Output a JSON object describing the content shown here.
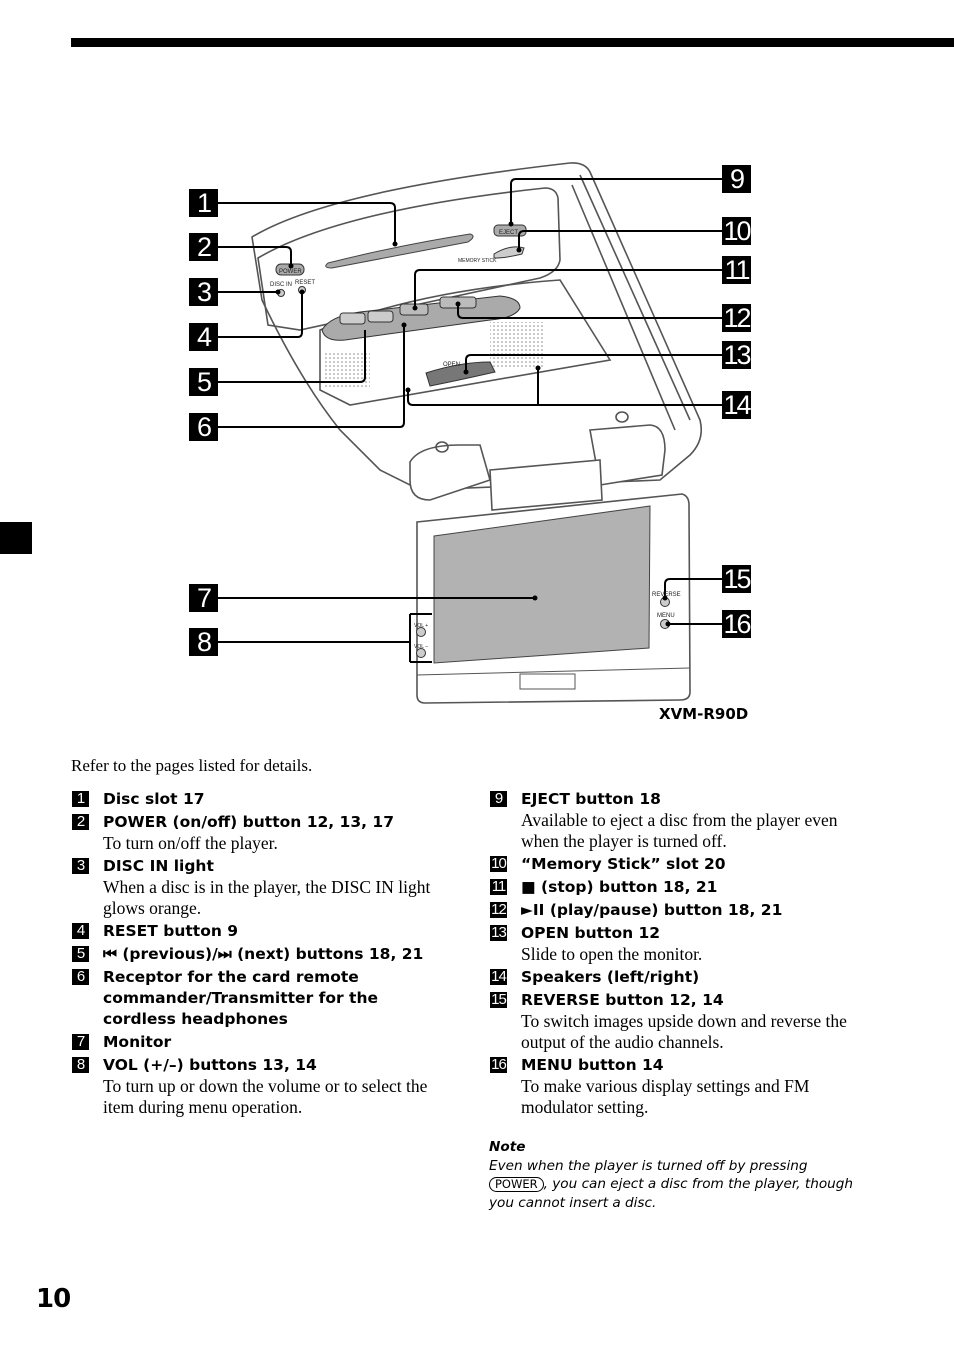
{
  "page": {
    "number": "10",
    "model": "XVM-R90D",
    "intro": "Refer to the pages listed for details."
  },
  "diagram": {
    "device_labels": {
      "power": "POWER",
      "disc_in": "DISC IN",
      "reset": "RESET",
      "eject": "EJECT",
      "memory_stick": "MEMORY STICK",
      "open": "OPEN",
      "reverse": "REVERSE",
      "menu": "MENU",
      "vol_plus": "VOL +",
      "vol_minus": "VOL –"
    },
    "callouts": [
      "1",
      "2",
      "3",
      "4",
      "5",
      "6",
      "7",
      "8",
      "9",
      "10",
      "11",
      "12",
      "13",
      "14",
      "15",
      "16"
    ]
  },
  "items_left": [
    {
      "num": "1",
      "title": "Disc slot 17",
      "desc": ""
    },
    {
      "num": "2",
      "title": "POWER (on/off) button  12, 13, 17",
      "desc": "To turn on/off the player."
    },
    {
      "num": "3",
      "title": "DISC IN light",
      "desc": "When a disc is in the player, the DISC IN light glows orange."
    },
    {
      "num": "4",
      "title": "RESET button  9",
      "desc": ""
    },
    {
      "num": "5",
      "title": "⏮ (previous)/⏭ (next) buttons  18, 21",
      "desc": ""
    },
    {
      "num": "6",
      "title": "Receptor for the card remote commander/Transmitter for the cordless headphones",
      "desc": ""
    },
    {
      "num": "7",
      "title": "Monitor",
      "desc": ""
    },
    {
      "num": "8",
      "title": "VOL (+/–) buttons  13, 14",
      "desc": "To turn up or down the volume or to select the item during menu operation."
    }
  ],
  "items_right": [
    {
      "num": "9",
      "title": "EJECT button  18",
      "desc": "Available to eject a disc from the player even when the player is turned off."
    },
    {
      "num": "10",
      "title": "“Memory Stick” slot  20",
      "desc": ""
    },
    {
      "num": "11",
      "title": "■ (stop) button  18, 21",
      "desc": ""
    },
    {
      "num": "12",
      "title": "►II (play/pause) button  18, 21",
      "desc": ""
    },
    {
      "num": "13",
      "title": "OPEN button  12",
      "desc": "Slide to open the monitor."
    },
    {
      "num": "14",
      "title": "Speakers (left/right)",
      "desc": ""
    },
    {
      "num": "15",
      "title": "REVERSE button  12, 14",
      "desc": "To switch images upside down and reverse the output of the audio channels."
    },
    {
      "num": "16",
      "title": "MENU button  14",
      "desc": "To make various display settings and FM modulator setting."
    }
  ],
  "note": {
    "title": "Note",
    "text_before": "Even when the player is turned off by pressing",
    "key": "POWER",
    "text_after": ", you can eject a disc from the player, though you cannot insert a disc."
  }
}
